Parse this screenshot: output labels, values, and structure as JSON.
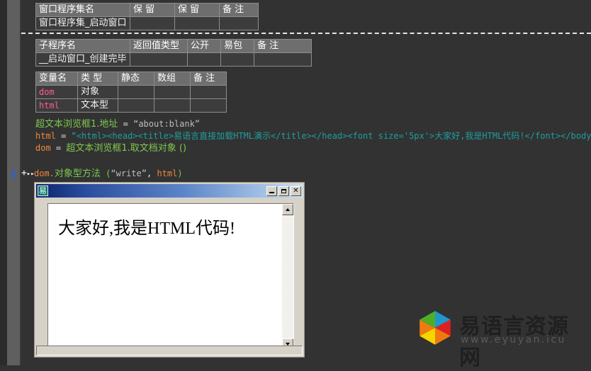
{
  "editor": {
    "program_table": {
      "headers": [
        "窗口程序集名",
        "保 留",
        "保 留",
        "备 注"
      ],
      "rows": [
        [
          "窗口程序集_启动窗口",
          "",
          "",
          ""
        ]
      ]
    },
    "subroutine_table": {
      "headers": [
        "子程序名",
        "返回值类型",
        "公开",
        "易包",
        "备 注"
      ],
      "rows": [
        [
          "__启动窗口_创建完毕",
          "",
          "",
          "",
          ""
        ]
      ]
    },
    "variable_table": {
      "headers": [
        "变量名",
        "类 型",
        "静态",
        "数组",
        "备 注"
      ],
      "rows": [
        [
          "dom",
          "对象",
          "",
          "",
          ""
        ],
        [
          "html",
          "文本型",
          "",
          "",
          ""
        ]
      ]
    },
    "code_lines": [
      {
        "target": "超文本浏览框1.地址",
        "operator": "=",
        "value": "“about:blank”"
      },
      {
        "target": "html",
        "operator": "=",
        "value": "“<html><head><title>易语言直接加载HTML演示</title></head><font size='5px'>大家好,我是HTML代码!</font></body></html>”"
      },
      {
        "target": "dom",
        "operator": "=",
        "value": "超文本浏览框1.取文档对象 ()"
      }
    ],
    "current_line": {
      "marker_plus": "+",
      "marker_chevron": "▸▸",
      "object": "dom.",
      "method": "对象型方法",
      "paren_open": "(",
      "arg1": "“write”",
      "comma": ",",
      "arg2": "html",
      "paren_close": ")"
    }
  },
  "preview_window": {
    "icon": "易",
    "icon_name": "eyuyan-app-icon",
    "title": "",
    "buttons": {
      "minimize": "minimize-icon",
      "maximize": "maximize-icon",
      "close": "✕"
    },
    "rendered_html_text": "大家好,我是HTML代码!",
    "scrollbar": {
      "up_arrow": "scroll-up-icon",
      "down_arrow": "scroll-down-icon"
    }
  },
  "watermark": {
    "brand_cn": "易语言资源网",
    "url": "www.eyuyan.icu",
    "logo_name": "cube-logo"
  },
  "colors": {
    "background": "#323232",
    "gutter": "#5f5f5f",
    "header_cell": "#6e6e6e",
    "cell": "#3c3c3c",
    "varname_pink": "#ff5e8a",
    "code_green": "#7ec850",
    "code_orange": "#f0873c",
    "code_cyan": "#1f9e9e",
    "code_gray": "#bdbdbd",
    "titlebar_blue": "#0a246a"
  }
}
